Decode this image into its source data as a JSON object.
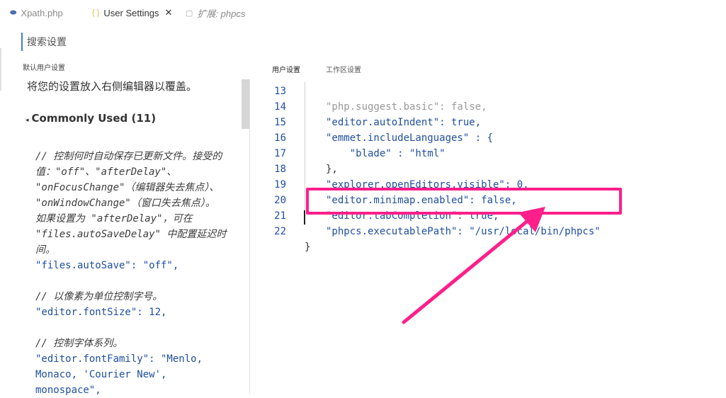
{
  "tabs": [
    {
      "label": "Xpath.php",
      "icon": "php-file-icon",
      "active": false
    },
    {
      "label": "User Settings",
      "icon": "json-braces-icon",
      "active": true,
      "close": "✕"
    },
    {
      "label": "扩展: phpcs",
      "icon": "file-icon",
      "active": false,
      "preview": true
    }
  ],
  "left": {
    "search_placeholder": "搜索设置",
    "header": "默认用户设置",
    "note": "将您的设置放入右侧编辑器以覆盖。",
    "group_label": "Commonly Used (11)",
    "code": [
      "// 控制何时自动保存已更新文件。接受的",
      "值：\"off\"、\"afterDelay\"、",
      "\"onFocusChange\"（编辑器失去焦点）、",
      "\"onWindowChange\"（窗口失去焦点）。",
      "如果设置为 \"afterDelay\"，可在",
      "\"files.autoSaveDelay\" 中配置延迟时",
      "间。",
      "\"files.autoSave\": \"off\",",
      "",
      "// 以像素为单位控制字号。",
      "\"editor.fontSize\": 12,",
      "",
      "// 控制字体系列。",
      "\"editor.fontFamily\": \"Menlo,",
      "Monaco, 'Courier New',",
      "monospace\","
    ]
  },
  "right": {
    "tab_user": "用户设置",
    "tab_workspace": "工作区设置",
    "lines": [
      {
        "num": "13",
        "text": "\"php.suggest.basic\": false,"
      },
      {
        "num": "14",
        "text": "\"editor.autoIndent\": true,"
      },
      {
        "num": "15",
        "text": "\"emmet.includeLanguages\" : {"
      },
      {
        "num": "16",
        "text": "    \"blade\" : \"html\""
      },
      {
        "num": "17",
        "text": "},"
      },
      {
        "num": "18",
        "text": "\"explorer.openEditors.visible\": 0,"
      },
      {
        "num": "19",
        "text": "\"editor.minimap.enabled\": false,"
      },
      {
        "num": "20",
        "text": "\"editor.tabCompletion\": true,"
      },
      {
        "num": "21",
        "text": "\"phpcs.executablePath\": \"/usr/local/bin/phpcs\""
      },
      {
        "num": "22",
        "text": "}"
      }
    ]
  },
  "colors": {
    "highlight": "#ff1f8a",
    "token": "#1f4fa0",
    "number": "#0c7a32"
  }
}
